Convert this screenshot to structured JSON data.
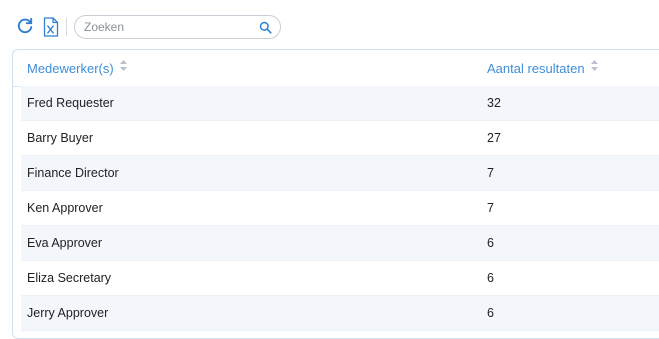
{
  "toolbar": {
    "refresh_icon": "refresh-icon",
    "excel_icon": "excel-export-icon",
    "search": {
      "placeholder": "Zoeken",
      "value": ""
    }
  },
  "table": {
    "columns": [
      "Medewerker(s)",
      "Aantal resultaten"
    ],
    "rows": [
      {
        "name": "Fred Requester",
        "count": "32"
      },
      {
        "name": "Barry Buyer",
        "count": "27"
      },
      {
        "name": "Finance Director",
        "count": "7"
      },
      {
        "name": "Ken Approver",
        "count": "7"
      },
      {
        "name": "Eva Approver",
        "count": "6"
      },
      {
        "name": "Eliza Secretary",
        "count": "6"
      },
      {
        "name": "Jerry Approver",
        "count": "6"
      }
    ]
  },
  "colors": {
    "accent": "#3e8ed8",
    "row_alt": "#f3f7fc",
    "border": "#cfe0f2"
  }
}
